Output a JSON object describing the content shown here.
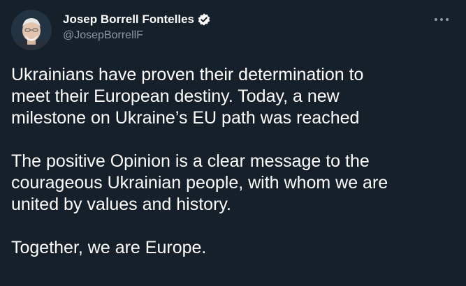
{
  "author": {
    "display_name": "Josep Borrell Fontelles",
    "handle": "@JosepBorrellF",
    "verified": true
  },
  "tweet": {
    "paragraphs": [
      [
        "Ukrainians have proven their determination to",
        "meet their European destiny. Today, a new",
        "milestone on Ukraine’s EU path was reached"
      ],
      [
        "The positive Opinion is a clear message to the",
        "courageous Ukrainian people, with whom we are",
        "united by values and history."
      ],
      [
        "Together, we are Europe."
      ]
    ]
  },
  "theme": {
    "background": "#15202b",
    "text": "#ffffff",
    "secondary_text": "#8b98a5",
    "verified_badge": "#ffffff"
  },
  "icons": {
    "verified": "verified-badge-icon",
    "more": "more-options-icon"
  }
}
